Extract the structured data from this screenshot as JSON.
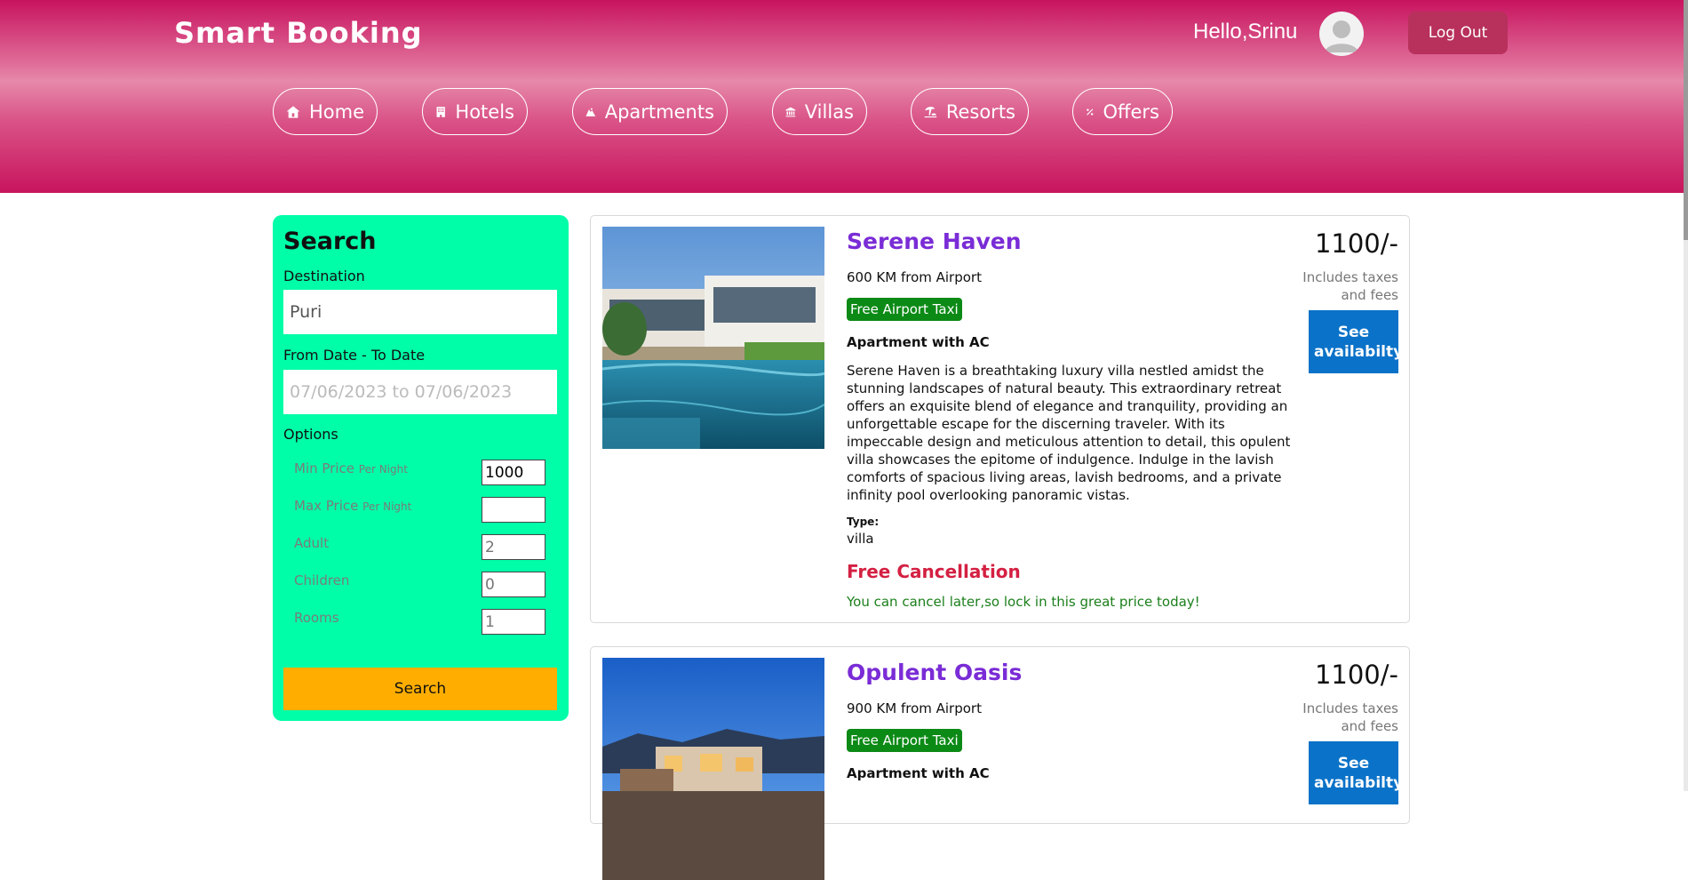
{
  "header": {
    "brand": "Smart Booking",
    "greeting": "Hello,Srinu",
    "logout_label": "Log Out",
    "nav": [
      {
        "label": "Home",
        "icon": "home-icon"
      },
      {
        "label": "Hotels",
        "icon": "hotel-icon"
      },
      {
        "label": "Apartments",
        "icon": "apartment-icon"
      },
      {
        "label": "Villas",
        "icon": "villa-icon"
      },
      {
        "label": "Resorts",
        "icon": "resort-icon"
      },
      {
        "label": "Offers",
        "icon": "offers-icon"
      }
    ]
  },
  "search": {
    "title": "Search",
    "destination_label": "Destination",
    "destination_value": "Puri",
    "date_label": "From Date - To Date",
    "date_placeholder": "07/06/2023 to 07/06/2023",
    "options_label": "Options",
    "min_price_label": "Min Price",
    "max_price_label": "Max Price",
    "per_night": "Per Night",
    "min_price_value": "1000",
    "max_price_value": "",
    "adult_label": "Adult",
    "adult_placeholder": "2",
    "children_label": "Children",
    "children_placeholder": "0",
    "rooms_label": "Rooms",
    "rooms_placeholder": "1",
    "button_label": "Search"
  },
  "listings": [
    {
      "name": "Serene Haven",
      "distance": "600 KM from Airport",
      "taxi": "Free Airport Taxi",
      "subtitle": "Apartment with AC",
      "description": "Serene Haven is a breathtaking luxury villa nestled amidst the stunning landscapes of natural beauty. This extraordinary retreat offers an exquisite blend of elegance and tranquility, providing an unforgettable escape for the discerning traveler. With its impeccable design and meticulous attention to detail, this opulent villa showcases the epitome of indulgence. Indulge in the lavish comforts of spacious living areas, lavish bedrooms, and a private infinity pool overlooking panoramic vistas.",
      "type_label": "Type:",
      "type_value": "villa",
      "cancel_title": "Free Cancellation",
      "cancel_sub": "You can cancel later,so lock in this great price today!",
      "price": "1100/-",
      "taxes": "Includes taxes and fees",
      "button": "See availabilty"
    },
    {
      "name": "Opulent Oasis",
      "distance": "900 KM from Airport",
      "taxi": "Free Airport Taxi",
      "subtitle": "Apartment with AC",
      "price": "1100/-",
      "taxes": "Includes taxes and fees",
      "button": "See availabilty"
    }
  ]
}
